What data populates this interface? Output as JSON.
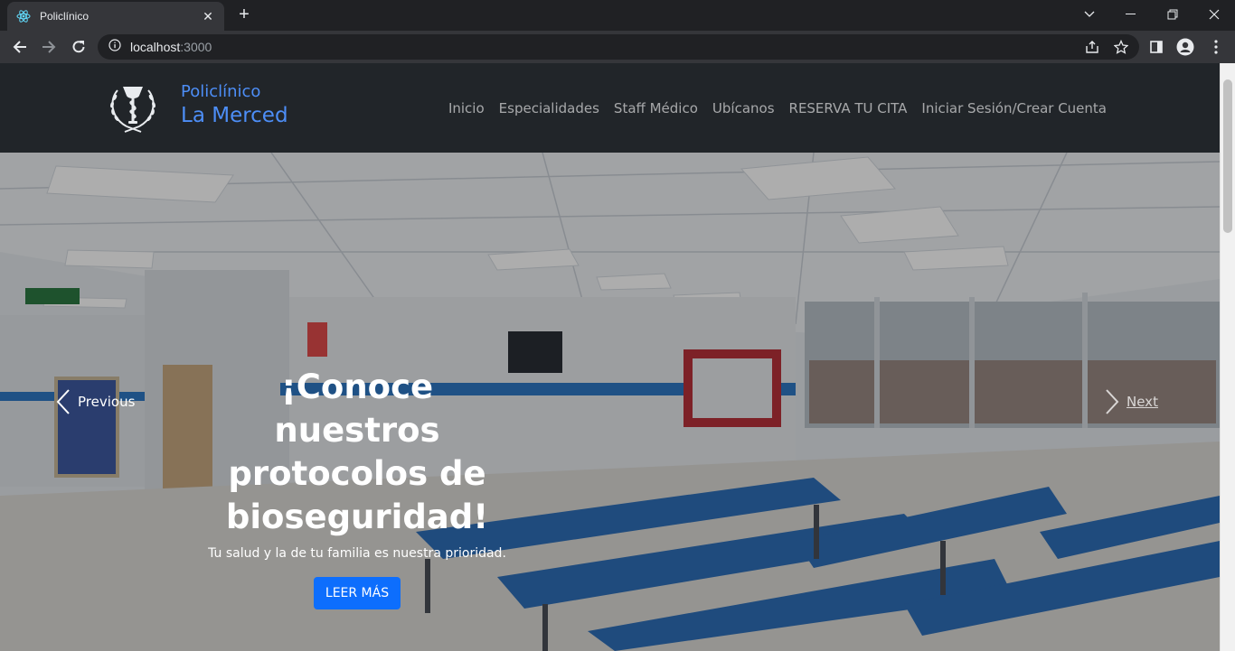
{
  "browser": {
    "tab_title": "Policlínico",
    "url_host": "localhost",
    "url_port": ":3000",
    "icons": [
      "react-favicon-icon",
      "close-icon",
      "plus-icon",
      "chevron-down-icon",
      "minimize-icon",
      "restore-icon",
      "close-window-icon",
      "back-arrow-icon",
      "forward-arrow-icon",
      "reload-icon",
      "info-icon",
      "share-icon",
      "star-icon",
      "side-panel-icon",
      "profile-icon",
      "more-vert-icon"
    ]
  },
  "site": {
    "brand_line1": "Policlínico",
    "brand_line2": "La Merced",
    "nav": [
      "Inicio",
      "Especialidades",
      "Staff Médico",
      "Ubícanos",
      "RESERVA TU CITA",
      "Iniciar Sesión/Crear Cuenta"
    ]
  },
  "carousel": {
    "title": "¡Conoce nuestros protocolos de bioseguridad!",
    "subtitle": "Tu salud y la de tu familia es nuestra prioridad.",
    "cta": "LEER MÁS",
    "prev": "Previous",
    "next": "Next"
  },
  "colors": {
    "brand_blue": "#4d8ef7",
    "nav_bg": "#212529",
    "button_blue": "#0d6efd"
  }
}
